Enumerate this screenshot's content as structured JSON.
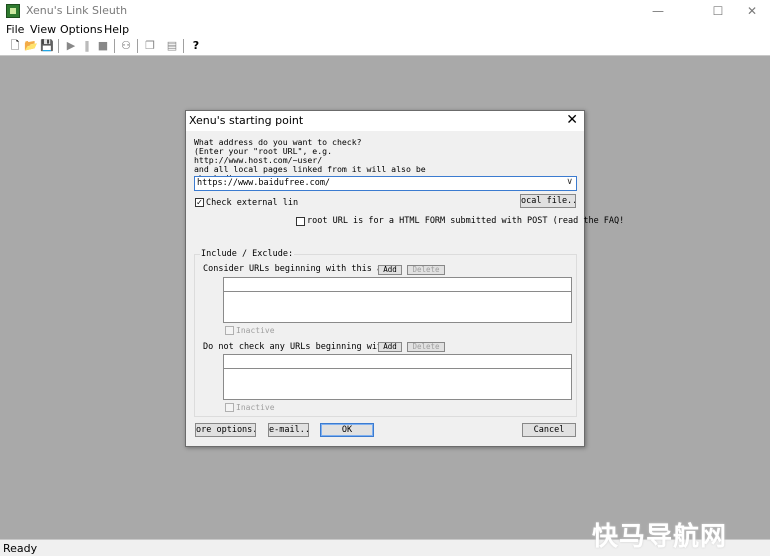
{
  "window": {
    "title": "Xenu's Link Sleuth",
    "minimize": "—",
    "maximize": "☐",
    "close": "✕"
  },
  "menu": [
    "File",
    "View",
    "Options",
    "Help"
  ],
  "toolbar": {
    "icons": [
      "new-file-icon",
      "open-folder-icon",
      "save-icon",
      "play-icon",
      "pause-icon",
      "stop-icon",
      "binoculars-icon",
      "copy-icon",
      "properties-icon",
      "help-icon"
    ],
    "glyphs": {
      "new": "🗋",
      "open": "📂",
      "save": "💾",
      "play": "▶",
      "pause": "‖",
      "stop": "■",
      "find": "⚇",
      "copy": "❐",
      "props": "▤",
      "help": "?"
    }
  },
  "status": {
    "text": "Ready"
  },
  "watermark": "快马导航网",
  "dialog": {
    "title": "Xenu's starting point",
    "close": "✕",
    "prompt": "What address do you want to check?\n(Enter your \"root URL\", e.g.\nhttp://www.host.com/~user/\nand all local pages linked from it will also be\nchecked)",
    "url_value": "https://www.baidufree.com/",
    "combo_arrow": "∨",
    "check_external_label": "Check external lin",
    "check_external_checked": true,
    "check_mark": "✓",
    "local_file_button": "ocal file...",
    "form_post_label": "root URL is for a HTML FORM submitted with POST (read the FAQ!",
    "form_post_checked": false,
    "include_exclude_title": "Include / Exclude:",
    "consider_label": "Consider URLs beginning with this as",
    "do_not_check_label": "Do not check any URLs beginning with",
    "add_button": "Add",
    "delete_button": "Delete",
    "inactive_label": "Inactive",
    "more_options_button": "ore options..",
    "email_button": "e-mail...",
    "ok_button": "OK",
    "cancel_button": "Cancel"
  }
}
